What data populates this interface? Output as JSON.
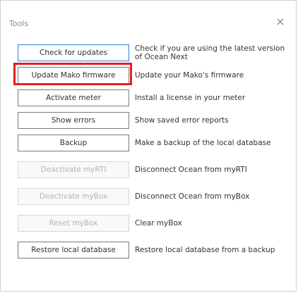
{
  "window": {
    "title": "Tools",
    "close_glyph": "×"
  },
  "tools": [
    {
      "button": "Check for updates",
      "description": "Check if you are using the latest version of Ocean Next",
      "state": "primary"
    },
    {
      "button": "Update Mako firmware",
      "description": "Update your Mako's firmware",
      "state": "highlighted"
    },
    {
      "button": "Activate meter",
      "description": "Install a license in your meter",
      "state": "normal"
    },
    {
      "button": "Show errors",
      "description": "Show saved error reports",
      "state": "normal"
    },
    {
      "button": "Backup",
      "description": "Make a backup of the local database",
      "state": "normal"
    },
    {
      "button": "Deactivate myRTI",
      "description": "Disconnect Ocean from myRTI",
      "state": "disabled"
    },
    {
      "button": "Deactivate myBox",
      "description": "Disconnect Ocean from myBox",
      "state": "disabled"
    },
    {
      "button": "Reset myBox",
      "description": "Clear myBox",
      "state": "disabled"
    },
    {
      "button": "Restore local database",
      "description": "Restore local database from a backup",
      "state": "normal"
    }
  ],
  "colors": {
    "highlight": "#e02020",
    "primary_border": "#2f7fd6",
    "disabled_text": "#b3b3b3"
  }
}
